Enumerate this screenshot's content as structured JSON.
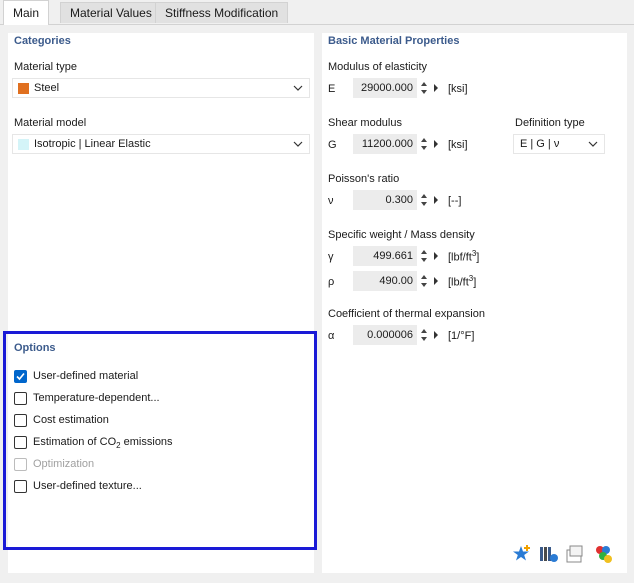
{
  "tabs": [
    {
      "label": "Main",
      "active": true
    },
    {
      "label": "Material Values",
      "active": false
    },
    {
      "label": "Stiffness Modification",
      "active": false
    }
  ],
  "categories": {
    "title": "Categories",
    "material_type_label": "Material type",
    "material_type_value": "Steel",
    "material_type_color": "#e07020",
    "material_model_label": "Material model",
    "material_model_value": "Isotropic | Linear Elastic",
    "material_model_color": "#d4f4f8"
  },
  "options": {
    "title": "Options",
    "items": [
      {
        "label": "User-defined material",
        "checked": true,
        "disabled": false
      },
      {
        "label": "Temperature-dependent...",
        "checked": false,
        "disabled": false
      },
      {
        "label": "Cost estimation",
        "checked": false,
        "disabled": false
      },
      {
        "label_prefix": "Estimation of CO",
        "label_sub": "2",
        "label_suffix": " emissions",
        "checked": false,
        "disabled": false
      },
      {
        "label": "Optimization",
        "checked": false,
        "disabled": true
      },
      {
        "label": "User-defined texture...",
        "checked": false,
        "disabled": false
      }
    ]
  },
  "basic": {
    "title": "Basic Material Properties",
    "modulus": {
      "heading": "Modulus of elasticity",
      "symbol": "E",
      "value": "29000.000",
      "unit": "[ksi]"
    },
    "shear": {
      "heading": "Shear modulus",
      "symbol": "G",
      "value": "11200.000",
      "unit": "[ksi]"
    },
    "definition": {
      "heading": "Definition type",
      "value": "E | G | ν"
    },
    "poisson": {
      "heading": "Poisson's ratio",
      "symbol": "ν",
      "value": "0.300",
      "unit": "[--]"
    },
    "weight": {
      "heading": "Specific weight / Mass density",
      "gamma": {
        "symbol": "γ",
        "value": "499.661",
        "unit_base": "[lbf/ft",
        "unit_sup": "3",
        "unit_end": "]"
      },
      "rho": {
        "symbol": "ρ",
        "value": "490.00",
        "unit_base": "[lb/ft",
        "unit_sup": "3",
        "unit_end": "]"
      }
    },
    "thermal": {
      "heading": "Coefficient of thermal expansion",
      "symbol": "α",
      "value": "0.000006",
      "unit": "[1/°F]"
    }
  },
  "toolbar": {
    "icons": [
      "star-add-icon",
      "library-icon",
      "export-icon",
      "color-palette-icon"
    ]
  },
  "colors": {
    "accent": "#3c5b8c",
    "highlight": "#1a1ad6",
    "check": "#0066cc"
  }
}
